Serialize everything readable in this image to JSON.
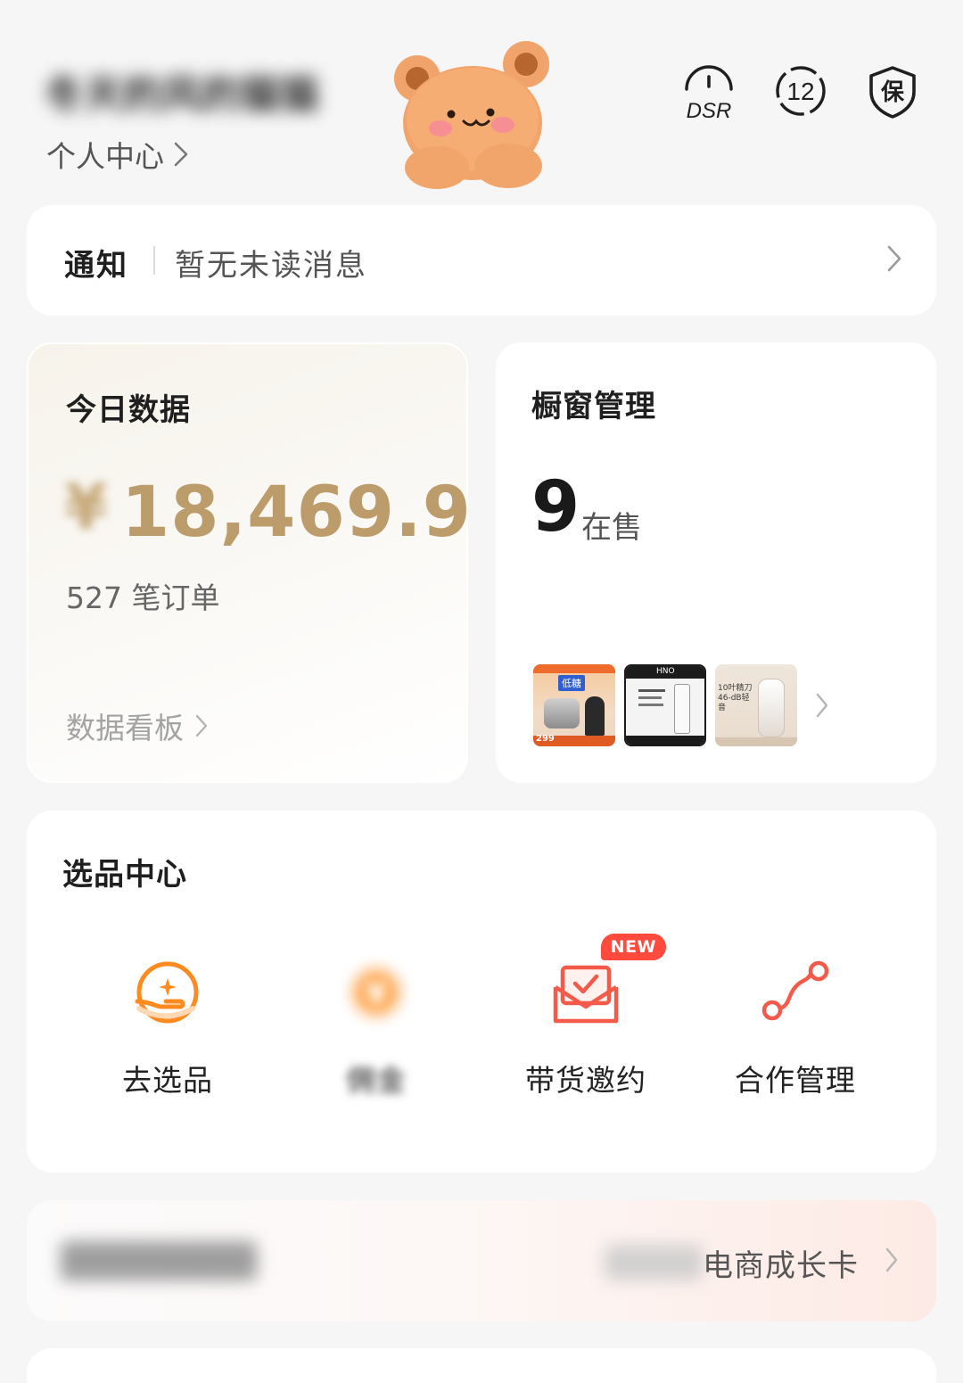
{
  "header": {
    "user_name": "冬天的风的猫猫",
    "personal_center_label": "个人中心",
    "icons": [
      "dsr-speedometer-icon",
      "level-12-badge-icon",
      "guarantee-shield-icon"
    ],
    "dsr_label": "DSR",
    "level_label": "12",
    "guarantee_label": "保"
  },
  "notice": {
    "title": "通知",
    "text": "暂无未读消息"
  },
  "today_data": {
    "title": "今日数据",
    "currency": "¥",
    "amount": "18,469.9",
    "orders": "527 笔订单",
    "dashboard_link": "数据看板"
  },
  "showcase": {
    "title": "橱窗管理",
    "on_sale_count": "9",
    "on_sale_label": "在售",
    "thumbnails": [
      {
        "badge": "低糖",
        "price": "299"
      },
      {
        "brand": "HNO"
      },
      {
        "caption": "10叶精刀 46-dB轻音"
      }
    ]
  },
  "selection_center": {
    "title": "选品中心",
    "entries": [
      {
        "label": "去选品",
        "icon": "hand-star-icon"
      },
      {
        "label": "佣金",
        "icon": "yuan-coin-icon"
      },
      {
        "label": "带货邀约",
        "icon": "invitation-envelope-icon",
        "badge": "NEW"
      },
      {
        "label": "合作管理",
        "icon": "cooperation-path-icon"
      }
    ]
  },
  "growth": {
    "left_text": "Pro会员成长计划",
    "right_text": "电商成长卡"
  },
  "colors": {
    "accent_orange": "#ff8a1f",
    "accent_red": "#f45a4a",
    "gold": "#bd9c6c",
    "background": "#f6f6f6"
  }
}
